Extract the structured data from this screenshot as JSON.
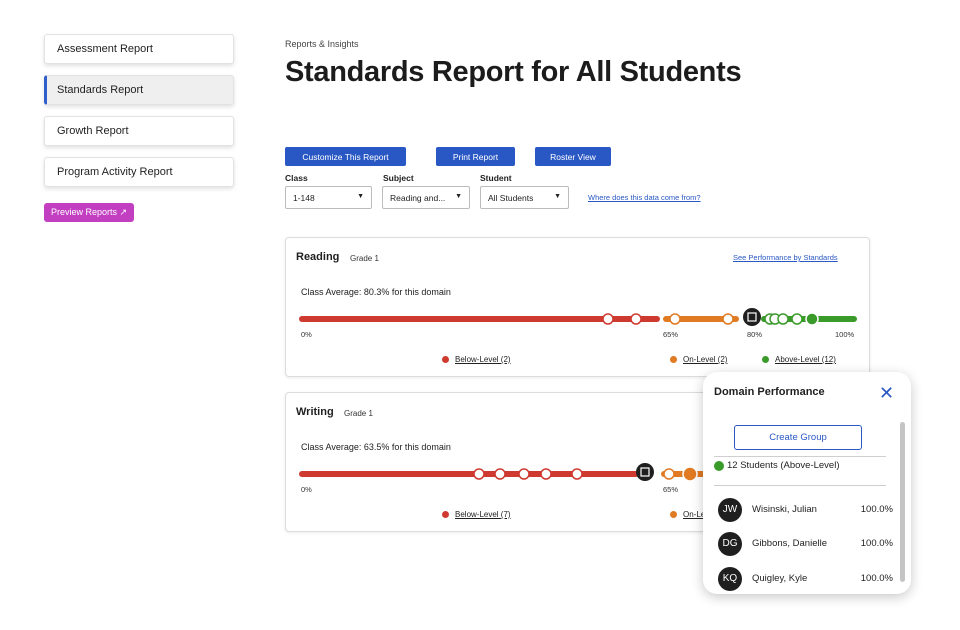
{
  "sidebar": {
    "items": [
      {
        "label": "Assessment Report"
      },
      {
        "label": "Standards Report"
      },
      {
        "label": "Growth Report"
      },
      {
        "label": "Program Activity Report"
      }
    ],
    "preview_label": "Preview Reports ↗"
  },
  "header": {
    "breadcrumb": "Reports & Insights",
    "title": "Standards Report for All Students"
  },
  "toolbar": {
    "customize": "Customize This Report",
    "print": "Print Report",
    "roster": "Roster View"
  },
  "filters": {
    "class": {
      "label": "Class",
      "value": "1-148"
    },
    "subject": {
      "label": "Subject",
      "value": "Reading and..."
    },
    "student": {
      "label": "Student",
      "value": "All Students"
    },
    "source_link": "Where does this data come from?"
  },
  "reading": {
    "title": "Reading",
    "grade": "Grade 1",
    "link": "See Performance by Standards",
    "average": "Class Average: 80.3% for this domain",
    "ticks": [
      "0%",
      "65%",
      "80%",
      "100%"
    ],
    "legend": {
      "below": "Below-Level (2)",
      "on": "On-Level (2)",
      "above": "Above-Level (12)"
    }
  },
  "writing": {
    "title": "Writing",
    "grade": "Grade 1",
    "average": "Class Average: 63.5% for this domain",
    "ticks": [
      "0%",
      "65%"
    ],
    "legend": {
      "below": "Below-Level (7)",
      "on": "On-Le"
    }
  },
  "popup": {
    "title": "Domain Performance",
    "create_group": "Create Group",
    "group_label": "12 Students (Above-Level)",
    "students": [
      {
        "initials": "JW",
        "name": "Wisinski, Julian",
        "score": "100.0%"
      },
      {
        "initials": "DG",
        "name": "Gibbons, Danielle",
        "score": "100.0%"
      },
      {
        "initials": "KQ",
        "name": "Quigley, Kyle",
        "score": "100.0%"
      }
    ]
  },
  "colors": {
    "below": "#cf3a30",
    "on": "#e07a23",
    "above": "#3a9a2a",
    "accent": "#2958c4",
    "preview": "#c23fc2"
  }
}
